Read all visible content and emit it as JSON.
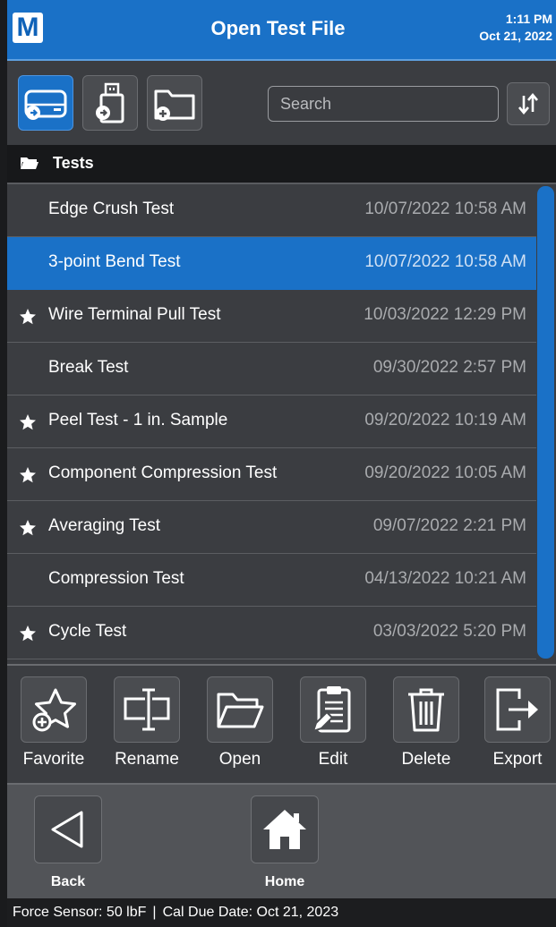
{
  "header": {
    "logo_letter": "M",
    "title": "Open Test File",
    "time": "1:11 PM",
    "date": "Oct 21, 2022"
  },
  "toolbar": {
    "buttons": [
      {
        "icon": "drive-icon",
        "active": true
      },
      {
        "icon": "usb-drive-icon",
        "active": false
      },
      {
        "icon": "new-folder-icon",
        "active": false
      }
    ],
    "search_placeholder": "Search",
    "sort_icon": "sort-icon"
  },
  "folder": {
    "icon": "open-folder-icon",
    "label": "Tests"
  },
  "tests": [
    {
      "name": "Edge Crush Test",
      "date": "10/07/2022 10:58 AM",
      "favorite": false,
      "selected": false
    },
    {
      "name": "3-point Bend Test",
      "date": "10/07/2022 10:58 AM",
      "favorite": false,
      "selected": true
    },
    {
      "name": "Wire Terminal Pull Test",
      "date": "10/03/2022 12:29 PM",
      "favorite": true,
      "selected": false
    },
    {
      "name": "Break Test",
      "date": "09/30/2022 2:57 PM",
      "favorite": false,
      "selected": false
    },
    {
      "name": "Peel Test - 1 in. Sample",
      "date": "09/20/2022 10:19 AM",
      "favorite": true,
      "selected": false
    },
    {
      "name": "Component Compression Test",
      "date": "09/20/2022 10:05 AM",
      "favorite": true,
      "selected": false
    },
    {
      "name": "Averaging Test",
      "date": "09/07/2022 2:21 PM",
      "favorite": true,
      "selected": false
    },
    {
      "name": "Compression Test",
      "date": "04/13/2022 10:21 AM",
      "favorite": false,
      "selected": false
    },
    {
      "name": "Cycle Test",
      "date": "03/03/2022 5:20 PM",
      "favorite": true,
      "selected": false
    }
  ],
  "actions": [
    {
      "label": "Favorite",
      "icon": "favorite-add-icon"
    },
    {
      "label": "Rename",
      "icon": "rename-icon"
    },
    {
      "label": "Open",
      "icon": "open-folder-icon"
    },
    {
      "label": "Edit",
      "icon": "edit-clipboard-icon"
    },
    {
      "label": "Delete",
      "icon": "trash-icon"
    },
    {
      "label": "Export",
      "icon": "export-icon"
    }
  ],
  "nav": {
    "back_label": "Back",
    "home_label": "Home"
  },
  "status": {
    "sensor": "Force Sensor: 50 lbF",
    "separator": "|",
    "cal_due": "Cal Due Date: Oct 21, 2023"
  },
  "colors": {
    "accent": "#1a71c7",
    "background": "#3b3d41",
    "status_bar": "#1c1d1f"
  }
}
